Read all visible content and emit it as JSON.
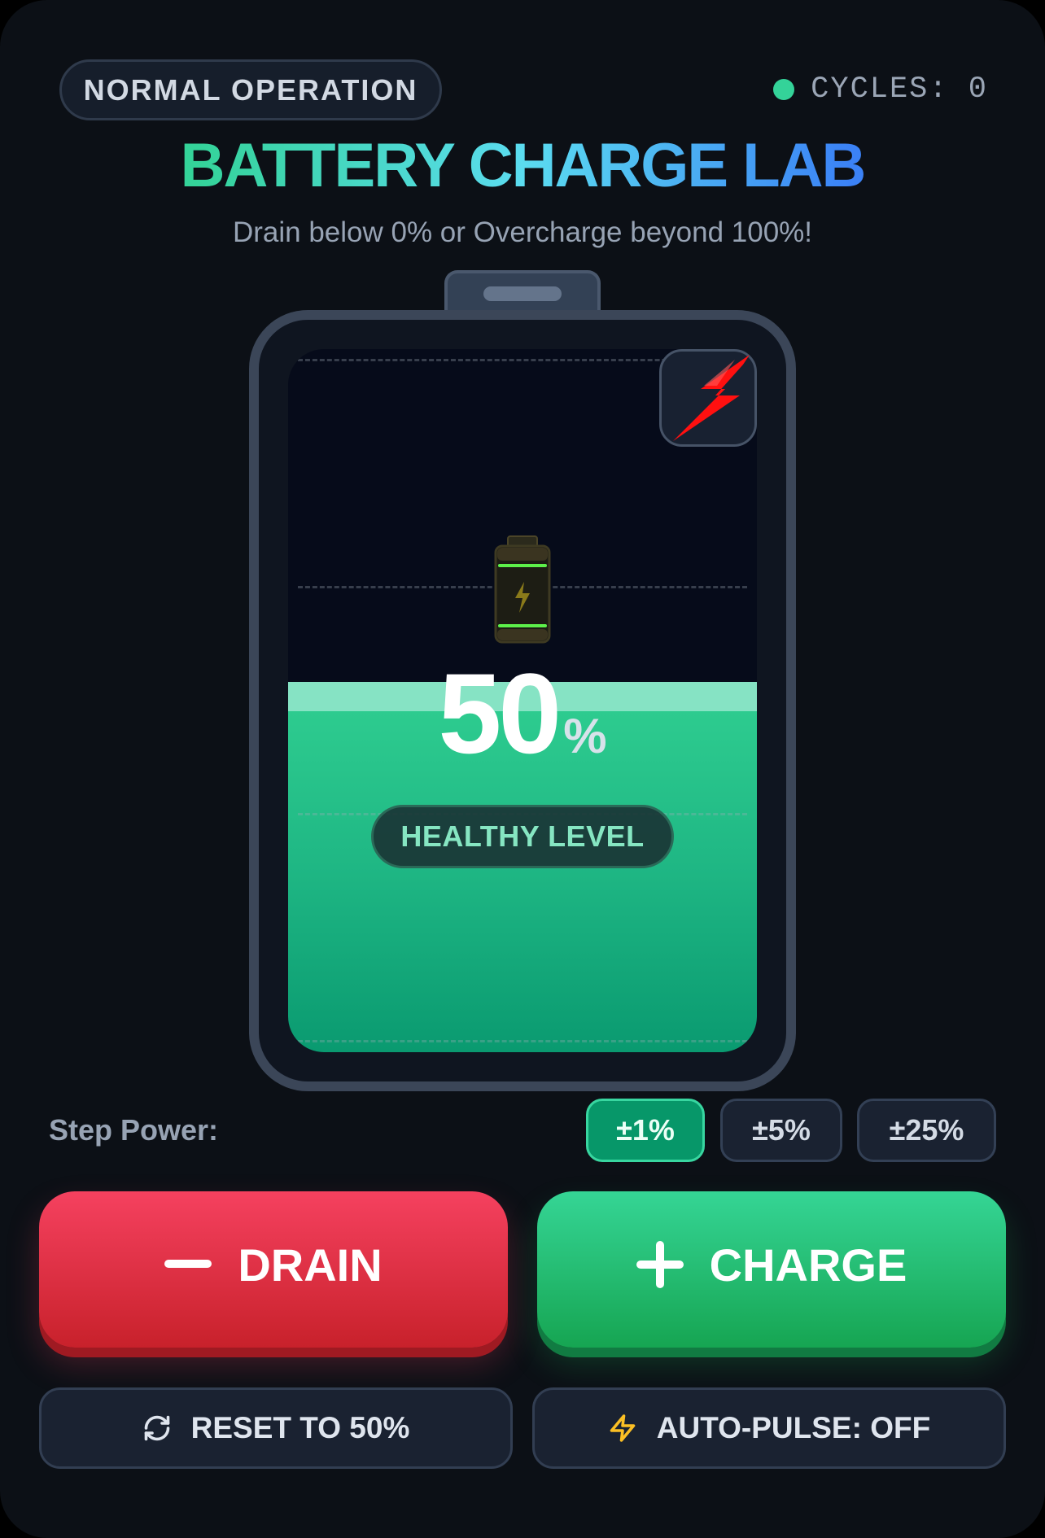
{
  "header": {
    "status": "NORMAL OPERATION",
    "cycles": "CYCLES: 0"
  },
  "title": "BATTERY CHARGE LAB",
  "subtitle": "Drain below 0% or Overcharge beyond 100%!",
  "battery": {
    "level_percent": 50,
    "value": "50",
    "unit": "%",
    "status_badge": "HEALTHY LEVEL"
  },
  "step_power": {
    "label": "Step Power:",
    "options": [
      "±1%",
      "±5%",
      "±25%"
    ],
    "selected": "±1%"
  },
  "actions": {
    "drain": "DRAIN",
    "charge": "CHARGE",
    "reset": "RESET TO 50%",
    "auto_pulse": "AUTO-PULSE: OFF"
  },
  "icons": {
    "status_dot": "status-dot-icon",
    "battery_center": "battery-icon",
    "power_toggle": "lightning-bolt-icon",
    "drain": "minus-icon",
    "charge": "plus-icon",
    "reset": "refresh-icon",
    "auto_pulse": "lightning-outline-icon"
  },
  "colors": {
    "title_gradient_start": "#34d399",
    "title_gradient_mid": "#5bdcf0",
    "title_gradient_end": "#3b82f6",
    "fill_top": "#30cf91",
    "fill_bottom": "#0a9a70",
    "drain": "#e11d48",
    "charge": "#22c55e",
    "active_step": "#079769",
    "status_ok": "#34d399",
    "bolt": "#ff1a1a"
  }
}
